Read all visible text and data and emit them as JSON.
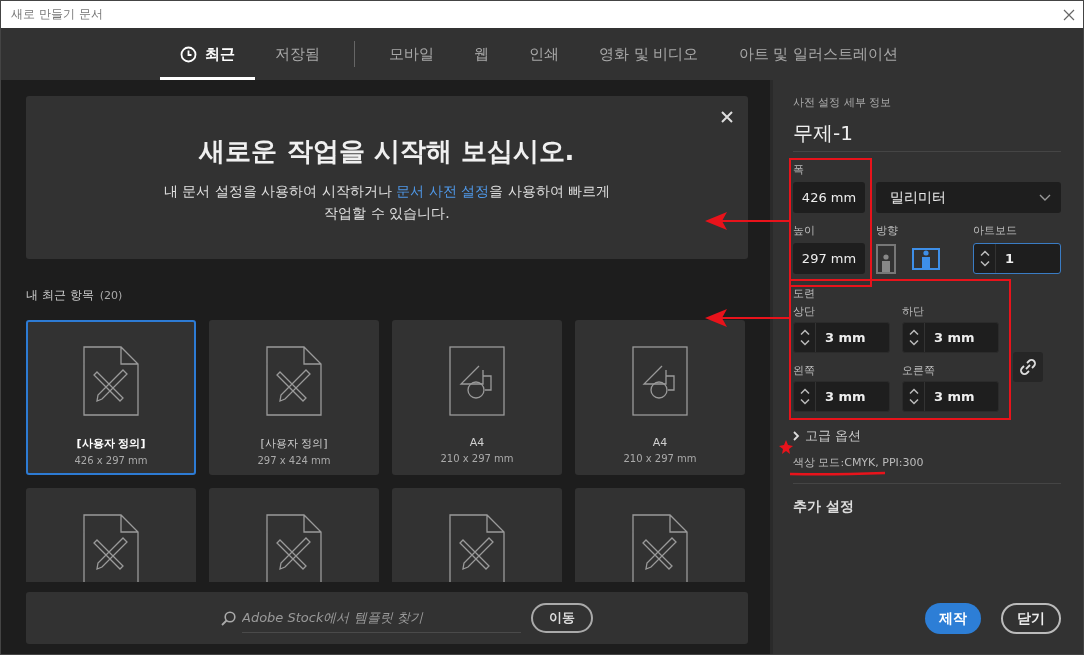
{
  "window": {
    "title": "새로 만들기 문서"
  },
  "tabs": [
    {
      "label": "최근",
      "selected": true
    },
    {
      "label": "저장됨",
      "selected": false
    },
    {
      "label": "모바일",
      "selected": false
    },
    {
      "label": "웹",
      "selected": false
    },
    {
      "label": "인쇄",
      "selected": false
    },
    {
      "label": "영화 및 비디오",
      "selected": false
    },
    {
      "label": "아트 및 일러스트레이션",
      "selected": false
    }
  ],
  "welcome": {
    "heading": "새로운 작업을 시작해 보십시오.",
    "text_before": "내 문서 설정을 사용하여 시작하거나 ",
    "link": "문서 사전 설정",
    "text_after": "을 사용하여 빠르게 작업할 수 있습니다."
  },
  "recent": {
    "title": "내 최근 항목",
    "count": "(20)",
    "items": [
      {
        "kind": "custom",
        "name": "[사용자 정의]",
        "size": "426 x 297 mm",
        "selected": true
      },
      {
        "kind": "custom",
        "name": "[사용자 정의]",
        "size": "297 x 424 mm",
        "selected": false
      },
      {
        "kind": "preset",
        "name": "A4",
        "size": "210 x 297 mm",
        "selected": false
      },
      {
        "kind": "preset",
        "name": "A4",
        "size": "210 x 297 mm",
        "selected": false
      },
      {
        "kind": "custom",
        "selected": false
      },
      {
        "kind": "custom",
        "selected": false
      },
      {
        "kind": "custom",
        "selected": false
      },
      {
        "kind": "custom",
        "selected": false
      }
    ]
  },
  "search": {
    "placeholder": "Adobe Stock에서 템플릿 찾기",
    "button": "이동"
  },
  "details": {
    "heading": "사전 설정 세부 정보",
    "name": "무제-1",
    "width_label": "폭",
    "width": "426 mm",
    "unit": "밀리미터",
    "height_label": "높이",
    "height": "297 mm",
    "orientation_label": "방향",
    "orientations": [
      {
        "kind": "portrait",
        "selected": false
      },
      {
        "kind": "landscape",
        "selected": true
      }
    ],
    "artboards_label": "아트보드",
    "artboards": "1",
    "bleed_label": "도련",
    "bleeds": [
      {
        "label": "상단",
        "value": "3 mm"
      },
      {
        "label": "하단",
        "value": "3 mm"
      },
      {
        "label": "왼쪽",
        "value": "3 mm"
      },
      {
        "label": "오른쪽",
        "value": "3 mm"
      }
    ],
    "advanced": "고급 옵션",
    "color_mode": "색상 모드:CMYK, PPI:300",
    "more": "추가 설정"
  },
  "buttons": [
    {
      "label": "제작",
      "kind": "primary"
    },
    {
      "label": "닫기",
      "kind": "secondary"
    }
  ]
}
